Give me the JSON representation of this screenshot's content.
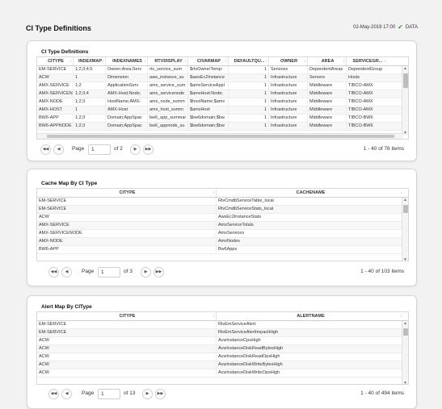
{
  "header": {
    "title": "CI Type Definitions",
    "timestamp": "02-May-2019 17:00",
    "status": "DATA",
    "status_icon": "check-icon",
    "status_color": "#3a9a3a"
  },
  "ci_types": {
    "title": "CI Type Definitions",
    "columns": [
      "CITYPE",
      "INDEXMAP",
      "INDEXNAMES",
      "RTVDISPLAY",
      "CIVARMAP",
      "DEFAULTQU...",
      "OWNER",
      "AREA",
      "SERVICEGR..."
    ],
    "rows": [
      [
        "EM-SERVICE",
        "1;2;3;4;5",
        "Owner;Area;Serv",
        "rtv_service_sum",
        "$rtvOwnerTemp:",
        "1",
        "Services",
        "DependentAreas",
        "DependentGroup"
      ],
      [
        "ACW",
        "1",
        "Dimension",
        "aaw_instance_su",
        "$awsEc2Instance",
        "1",
        "Infrastructure",
        "Servers",
        "Hosts"
      ],
      [
        "AMX-SERVICE",
        "1;2",
        "ApplicationServ",
        "amx_service_sum",
        "$amxServiceAppl",
        "1",
        "Infrastructure",
        "Middleware",
        "TIBCO-AMX"
      ],
      [
        "AMX-SERVICEN",
        "1;2;3;4",
        "AMX-Host;Node;",
        "amx_servicenode",
        "$amxHost:Node;",
        "1",
        "Infrastructure",
        "Middleware",
        "TIBCO-AMX"
      ],
      [
        "AMX-NODE",
        "1;2;3",
        "HostName;AMX-",
        "amx_node_summ",
        "$hostName;$amx",
        "1",
        "Infrastructure",
        "Middleware",
        "TIBCO-AMX"
      ],
      [
        "AMX-HOST",
        "1",
        "AMX-Host",
        "amx_host_summ",
        "$amxHost",
        "1",
        "Infrastructure",
        "Middleware",
        "TIBCO-AMX"
      ],
      [
        "BW6-APP",
        "1;2;3",
        "Domain;AppSpac",
        "bw6_app_summar",
        "$bw6domain;$bw",
        "1",
        "Infrastructure",
        "Middleware",
        "TIBCO-BW6"
      ],
      [
        "BW6-APPNODE",
        "1;2;3",
        "Domain;AppSpac",
        "bw6_appnode_su",
        "$bw6domain;$bw",
        "1",
        "Infrastructure",
        "Middleware",
        "TIBCO-BW6"
      ]
    ],
    "pager": {
      "page_label": "Page",
      "page_value": "1",
      "of_label": "of 2",
      "info": "1 - 40 of 76 items"
    }
  },
  "cache_map": {
    "title": "Cache Map By CI Type",
    "columns": [
      "CITYPE",
      "CACHENAME"
    ],
    "rows": [
      [
        "EM-SERVICE",
        "RtvCmdbServiceTable_local"
      ],
      [
        "EM-SERVICE",
        "RtvCmdbServiceStats_local"
      ],
      [
        "ACW",
        "AwsEc2InstanceStats"
      ],
      [
        "AMX-SERVICE",
        "AmxServiceTotals"
      ],
      [
        "AMX-SERVICENODE",
        "AmxServices"
      ],
      [
        "AMX-NODE",
        "AmxNodes"
      ],
      [
        "BW6-APP",
        "Bw6Apps"
      ]
    ],
    "pager": {
      "page_label": "Page",
      "page_value": "1",
      "of_label": "of 3",
      "info": "1 - 40 of 103 items"
    }
  },
  "alert_map": {
    "title": "Alert Map By CIType",
    "columns": [
      "CITYPE",
      "ALERTNAME"
    ],
    "rows": [
      [
        "EM-SERVICE",
        "RtvEmServiceAlert"
      ],
      [
        "EM-SERVICE",
        "RtvEmServiceAlertImpactHigh"
      ],
      [
        "ACW",
        "AcwInstanceCpuHigh"
      ],
      [
        "ACW",
        "AcwInstanceDiskReadBytesHigh"
      ],
      [
        "ACW",
        "AcwInstanceDiskReadOpsHigh"
      ],
      [
        "ACW",
        "AcwInstanceDiskWriteBytesHigh"
      ],
      [
        "ACW",
        "AcwInstanceDiskWriteOpsHigh"
      ]
    ],
    "pager": {
      "page_label": "Page",
      "page_value": "1",
      "of_label": "of 13",
      "info": "1 - 40 of 494 items"
    }
  },
  "icons": {
    "first_page": "first-page-icon",
    "prev_page": "prev-page-icon",
    "next_page": "next-page-icon",
    "last_page": "last-page-icon",
    "sort": "sort-icon"
  }
}
